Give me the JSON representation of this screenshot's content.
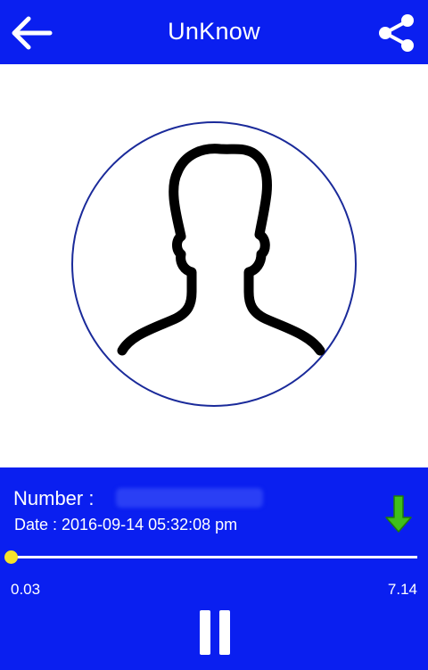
{
  "appbar": {
    "title": "UnKnow",
    "back_icon": "arrow-left-icon",
    "share_icon": "share-icon"
  },
  "avatar": {
    "icon": "person-silhouette-icon"
  },
  "details": {
    "number_label": "Number :",
    "number_value": "",
    "date_label": "Date : 2016-09-14 05:32:08 pm",
    "download_icon": "arrow-down-icon"
  },
  "player": {
    "current_time": "0.03",
    "total_time": "7.14",
    "progress_fraction": 0.004,
    "control_icon": "pause-icon"
  },
  "colors": {
    "primary": "#0a1ff0",
    "seek_accent": "#f5e32a",
    "download_green": "#3fbf1a",
    "circle_border": "#1a2a9a"
  }
}
